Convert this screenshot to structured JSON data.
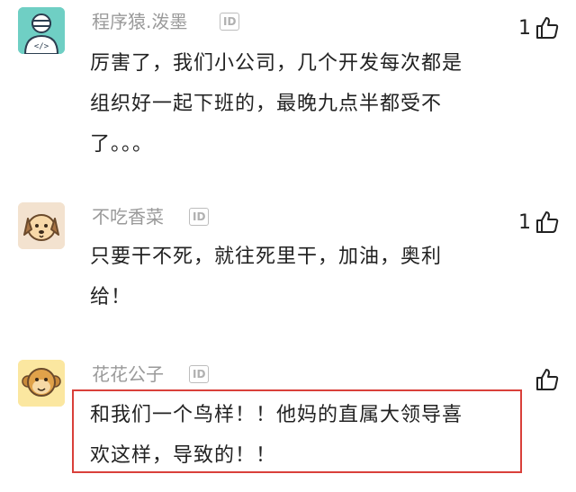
{
  "comments": [
    {
      "username": "程序猿.泼墨",
      "badge": "ID",
      "likes": "1",
      "lines": [
        "厉害了，我们小公司，几个开发每次都是",
        "组织好一起下班的，最晚九点半都受不",
        "了。。。"
      ],
      "avatar": "programmer-avatar"
    },
    {
      "username": "不吃香菜",
      "badge": "ID",
      "likes": "1",
      "lines": [
        "只要干不死，就往死里干，加油，奥利",
        "给！"
      ],
      "avatar": "dog-avatar"
    },
    {
      "username": "花花公子",
      "badge": "ID",
      "likes": "",
      "lines": [
        "和我们一个鸟样！！他妈的直属大领导喜",
        "欢这样，导致的！！"
      ],
      "avatar": "monkey-avatar"
    }
  ],
  "colors": {
    "username": "#9a9a9a",
    "text": "#222222",
    "highlight": "#d9403a"
  },
  "icons": [
    "thumbs-up-icon",
    "id-badge-icon"
  ]
}
